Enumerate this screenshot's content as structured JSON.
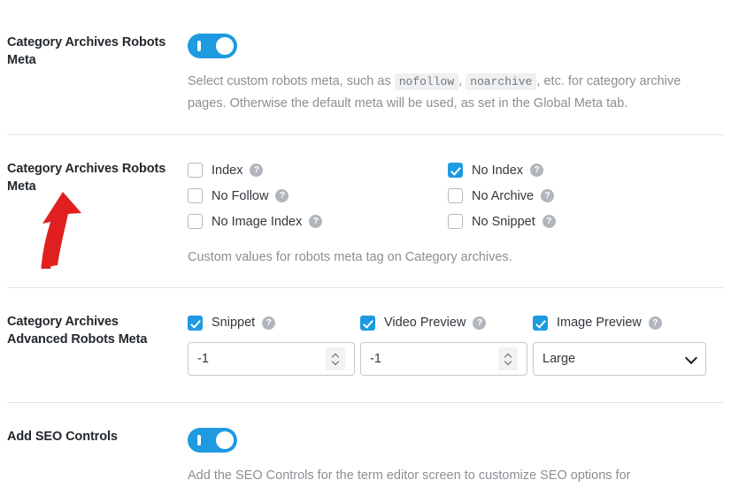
{
  "sections": [
    {
      "label": "Category Archives Robots Meta",
      "toggle": {
        "name": "category-archives-robots-meta-toggle",
        "on": true
      },
      "description_parts": [
        {
          "type": "text",
          "value": "Select custom robots meta, such as "
        },
        {
          "type": "code",
          "value": "nofollow"
        },
        {
          "type": "text",
          "value": ", "
        },
        {
          "type": "code",
          "value": "noarchive"
        },
        {
          "type": "text",
          "value": ", etc. for category archive pages. Otherwise the default meta will be used, as set in the Global Meta tab."
        }
      ]
    },
    {
      "label": "Category Archives Robots Meta",
      "checkboxes": [
        {
          "label": "Index",
          "checked": false
        },
        {
          "label": "No Index",
          "checked": true
        },
        {
          "label": "No Follow",
          "checked": false
        },
        {
          "label": "No Archive",
          "checked": false
        },
        {
          "label": "No Image Index",
          "checked": false
        },
        {
          "label": "No Snippet",
          "checked": false
        }
      ],
      "description": "Custom values for robots meta tag on Category archives."
    },
    {
      "label": "Category Archives Advanced Robots Meta",
      "controls": [
        {
          "label": "Snippet",
          "checked": true,
          "kind": "number",
          "value": "-1"
        },
        {
          "label": "Video Preview",
          "checked": true,
          "kind": "number",
          "value": "-1"
        },
        {
          "label": "Image Preview",
          "checked": true,
          "kind": "select",
          "value": "Large"
        }
      ]
    },
    {
      "label": "Add SEO Controls",
      "toggle": {
        "name": "add-seo-controls-toggle",
        "on": true
      },
      "description": "Add the SEO Controls for the term editor screen to customize SEO options for"
    }
  ],
  "icons": {
    "help": "?",
    "help_icon_name": "help-icon"
  },
  "annotation": {
    "name": "red-arrow-annotation",
    "color": "#e02020",
    "points_to": "Category Archives Robots Meta"
  },
  "colors": {
    "accent": "#1e9ae0",
    "label_text": "#23282d",
    "body_text": "#32373c",
    "muted_text": "#8a8f94",
    "separator": "#e2e4e7",
    "annotation_red": "#e02020"
  }
}
